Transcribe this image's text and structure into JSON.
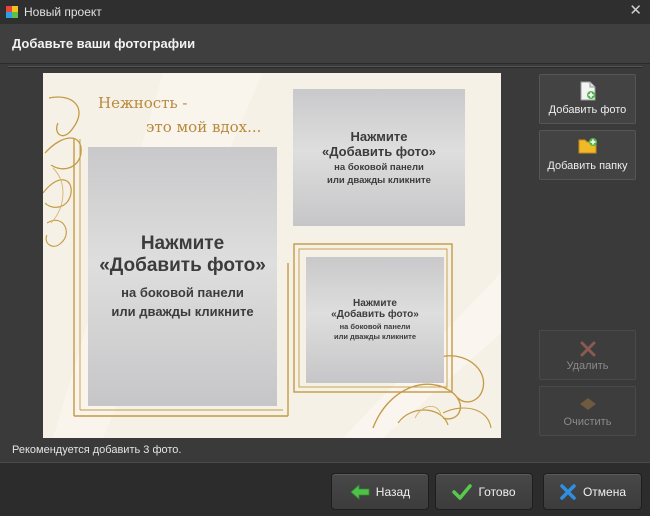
{
  "window": {
    "title": "Новый проект",
    "close_glyph": "✕"
  },
  "header": {
    "title": "Добавьте ваши фотографии"
  },
  "canvas": {
    "quote_line1": "Нежность -",
    "quote_line2": "это мой вдох...",
    "placeholders": [
      {
        "line1": "Нажмите",
        "line2": "«Добавить фото»",
        "line3a": "на боковой панели",
        "line3b": "или дважды кликните"
      },
      {
        "line1": "Нажмите",
        "line2": "«Добавить фото»",
        "line3a": "на боковой панели",
        "line3b": "или дважды кликните"
      },
      {
        "line1": "Нажмите",
        "line2": "«Добавить фото»",
        "line3a": "на боковой панели",
        "line3b": "или дважды кликните"
      }
    ],
    "colors": {
      "gold": "#c49a45",
      "background": "#f6f1e6"
    }
  },
  "sidebar": {
    "add_photo": "Добавить фото",
    "add_folder": "Добавить папку",
    "delete": "Удалить",
    "clear": "Очистить"
  },
  "status": {
    "hint": "Рекомендуется добавить 3 фото."
  },
  "footer": {
    "back": "Назад",
    "done": "Готово",
    "cancel": "Отмена"
  },
  "icons": {
    "app": "app-logo-icon",
    "add_photo": "add-photo-icon",
    "add_folder": "add-folder-icon",
    "delete": "delete-x-icon",
    "clear": "clear-diamond-icon",
    "back": "arrow-left-icon",
    "done": "checkmark-icon",
    "cancel": "cross-icon"
  }
}
